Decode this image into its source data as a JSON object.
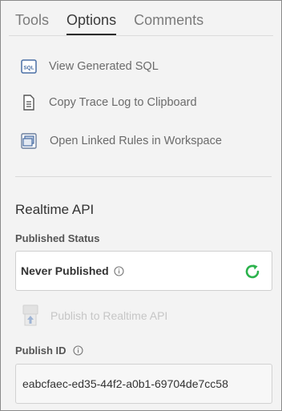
{
  "tabs": [
    {
      "label": "Tools",
      "active": false
    },
    {
      "label": "Options",
      "active": true
    },
    {
      "label": "Comments",
      "active": false
    }
  ],
  "actions": {
    "view_sql": {
      "label": "View Generated SQL",
      "icon": "sql-icon"
    },
    "copy_trace": {
      "label": "Copy Trace Log to Clipboard",
      "icon": "document-icon"
    },
    "open_linked": {
      "label": "Open Linked Rules in Workspace",
      "icon": "linked-windows-icon"
    }
  },
  "realtime": {
    "title": "Realtime API",
    "published_status_label": "Published Status",
    "status_value": "Never Published",
    "publish_button_label": "Publish to Realtime API",
    "publish_button_enabled": false,
    "publish_id_label": "Publish ID",
    "publish_id_value": "eabcfaec-ed35-44f2-a0b1-69704de7cc58"
  },
  "colors": {
    "refresh": "#2bb24c",
    "icon_blue": "#4a6fa5",
    "disabled_text": "#c6c6c6"
  }
}
